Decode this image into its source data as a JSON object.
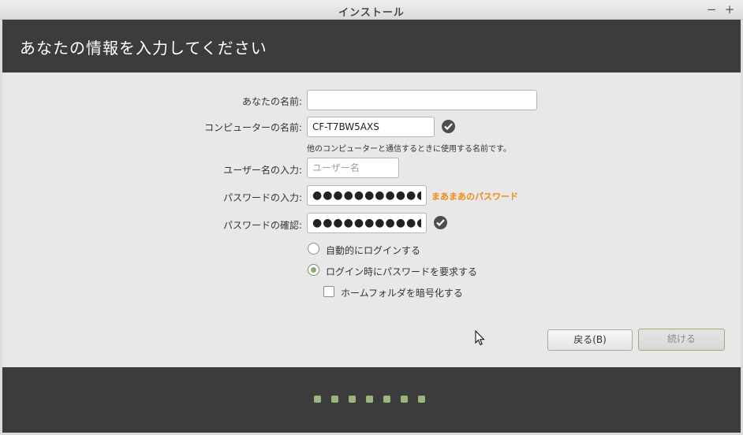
{
  "window": {
    "title": "インストール",
    "minimize_glyph": "−",
    "maximize_glyph": "+"
  },
  "header": {
    "title": "あなたの情報を入力してください"
  },
  "form": {
    "name": {
      "label": "あなたの名前:",
      "value": "",
      "placeholder": ""
    },
    "computer": {
      "label": "コンピューターの名前:",
      "value": "CF-T7BW5AXS",
      "hint": "他のコンピューターと通信するときに使用する名前です。",
      "status_icon": "check-icon"
    },
    "username": {
      "label": "ユーザー名の入力:",
      "value": "",
      "placeholder": "ユーザー名"
    },
    "password": {
      "label": "パスワードの入力:",
      "value": "●●●●●●●●●●●",
      "strength": "まあまあのパスワード",
      "strength_color": "#f08a10"
    },
    "confirm": {
      "label": "パスワードの確認:",
      "value": "●●●●●●●●●●●",
      "status_icon": "check-icon"
    },
    "options": {
      "auto_login": {
        "label": "自動的にログインする",
        "selected": false
      },
      "require_password": {
        "label": "ログイン時にパスワードを要求する",
        "selected": true
      },
      "encrypt_home": {
        "label": "ホームフォルダを暗号化する",
        "checked": false
      }
    }
  },
  "buttons": {
    "back": "戻る(B)",
    "continue": "続ける"
  },
  "progress": {
    "total_steps": 7
  },
  "colors": {
    "header_bg": "#3c3c3c",
    "accent": "#8fb573",
    "body_bg": "#e8e8e8"
  }
}
